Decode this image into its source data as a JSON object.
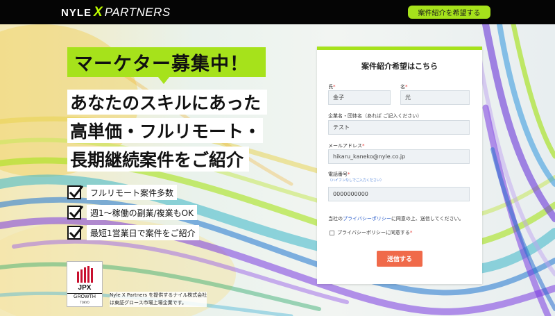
{
  "header": {
    "logo_nyle": "NYLE",
    "logo_x": "X",
    "logo_partners": "PARTNERS",
    "cta_label": "案件紹介を希望する"
  },
  "hero": {
    "badge": "マーケター募集中！",
    "headline_lines": [
      "あなたのスキルにあった",
      "高単価・フルリモート・",
      "長期継続案件をご紹介"
    ],
    "checks": [
      "フルリモート案件多数",
      "週1〜稼働の副業/複業もOK",
      "最短1営業日で案件をご紹介"
    ]
  },
  "jpx": {
    "logo_text": "JPX",
    "growth": "GROWTH",
    "tokyo": "TOKYO",
    "note_line1": "Nyle X Partners を提供するナイル株式会社",
    "note_line2": "は東証グロース市場上場企業です。"
  },
  "form": {
    "title": "案件紹介希望はこちら",
    "last_name": {
      "label": "氏",
      "value": "金子"
    },
    "first_name": {
      "label": "名",
      "value": "光"
    },
    "company": {
      "label": "企業名・団体名（あれば ご記入ください）",
      "value": "テスト"
    },
    "email": {
      "label": "メールアドレス",
      "value": "hikaru_kaneko@nyle.co.jp"
    },
    "phone": {
      "label": "電話番号",
      "hint": "（ハイフンなしでご入力ください）",
      "value": "0000000000"
    },
    "required_mark": "*",
    "consent_prefix": "当社の",
    "consent_link": "プライバシーポリシー",
    "consent_suffix": "に同意の上、送信してください。",
    "consent_checkbox_label": "プライバシーポリシーに同意する",
    "submit_label": "送信する"
  },
  "colors": {
    "accent_green": "#a6e21b",
    "submit_coral": "#f06a4a",
    "link_blue": "#2a5cc8",
    "required_red": "#e53935"
  }
}
